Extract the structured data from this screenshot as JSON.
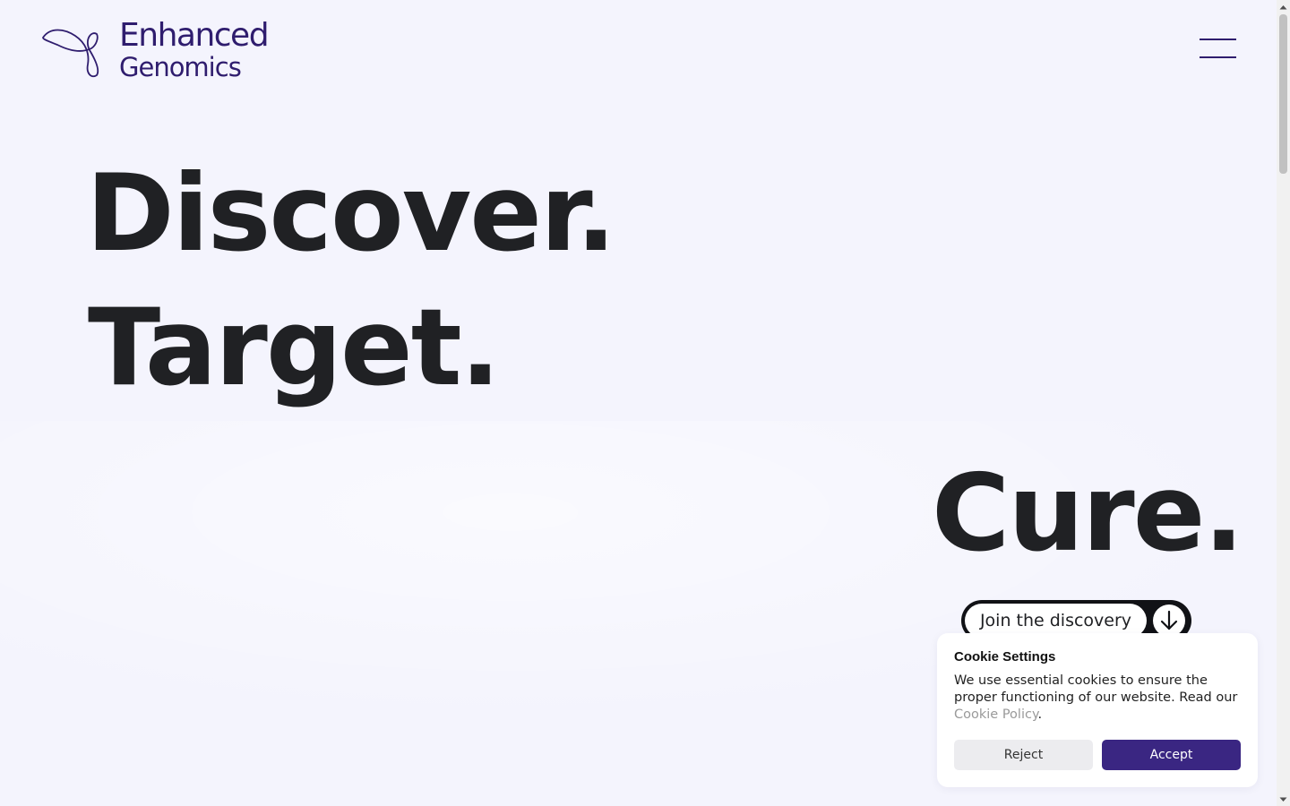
{
  "brand": {
    "logo_icon": "genomics-loop-icon",
    "name_line1": "Enhanced",
    "name_line2": "Genomics",
    "color": "#2f1d6e"
  },
  "header": {
    "menu_icon": "hamburger-menu-icon"
  },
  "hero": {
    "words": [
      "Discover.",
      "Target.",
      "Cure."
    ],
    "cta_label": "Join the discovery",
    "cta_icon": "arrow-down-icon"
  },
  "cookie": {
    "title": "Cookie Settings",
    "text_before_link": "We use essential cookies to ensure the proper functioning of our website. Read our ",
    "link_label": "Cookie Policy",
    "text_after_link": ".",
    "reject_label": "Reject",
    "accept_label": "Accept",
    "accept_color": "#3a2682"
  },
  "colors": {
    "background": "#f4f4fd",
    "text": "#202124"
  }
}
